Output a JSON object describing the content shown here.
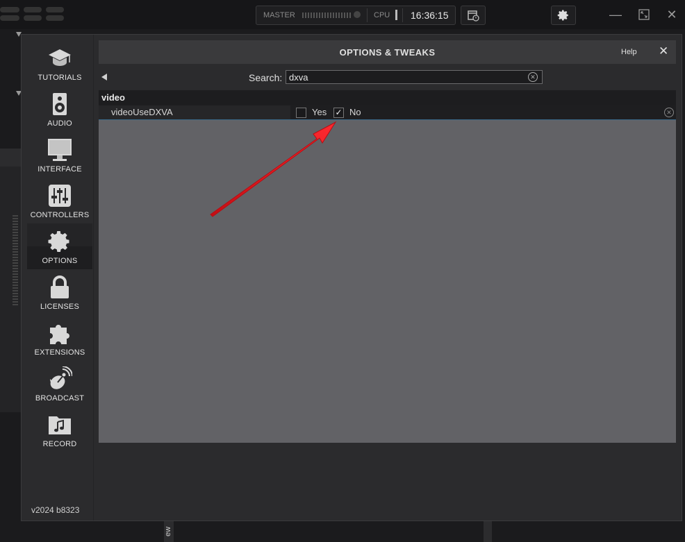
{
  "topbar": {
    "master_label": "MASTER",
    "cpu_label": "CPU",
    "clock": "16:36:15"
  },
  "sidebar": {
    "items": [
      {
        "label": "TUTORIALS",
        "icon": "graduation-cap-icon"
      },
      {
        "label": "AUDIO",
        "icon": "speaker-icon"
      },
      {
        "label": "INTERFACE",
        "icon": "monitor-icon"
      },
      {
        "label": "CONTROLLERS",
        "icon": "sliders-icon"
      },
      {
        "label": "OPTIONS",
        "icon": "gear-icon",
        "active": true
      },
      {
        "label": "LICENSES",
        "icon": "lock-icon"
      },
      {
        "label": "EXTENSIONS",
        "icon": "puzzle-icon"
      },
      {
        "label": "BROADCAST",
        "icon": "satellite-dish-icon"
      },
      {
        "label": "RECORD",
        "icon": "music-folder-icon"
      }
    ],
    "version": "v2024 b8323"
  },
  "dialog": {
    "title": "OPTIONS & TWEAKS",
    "help_label": "Help",
    "close_label": "✕"
  },
  "search": {
    "label": "Search:",
    "value": "dxva"
  },
  "results": {
    "section": "video",
    "rows": [
      {
        "name": "videoUseDXVA",
        "yes_label": "Yes",
        "no_label": "No",
        "yes_checked": false,
        "no_checked": true
      }
    ]
  },
  "background": {
    "bottom_tab": "ew"
  },
  "colors": {
    "annotation_arrow": "#e8141c",
    "content_bg": "#626266"
  }
}
